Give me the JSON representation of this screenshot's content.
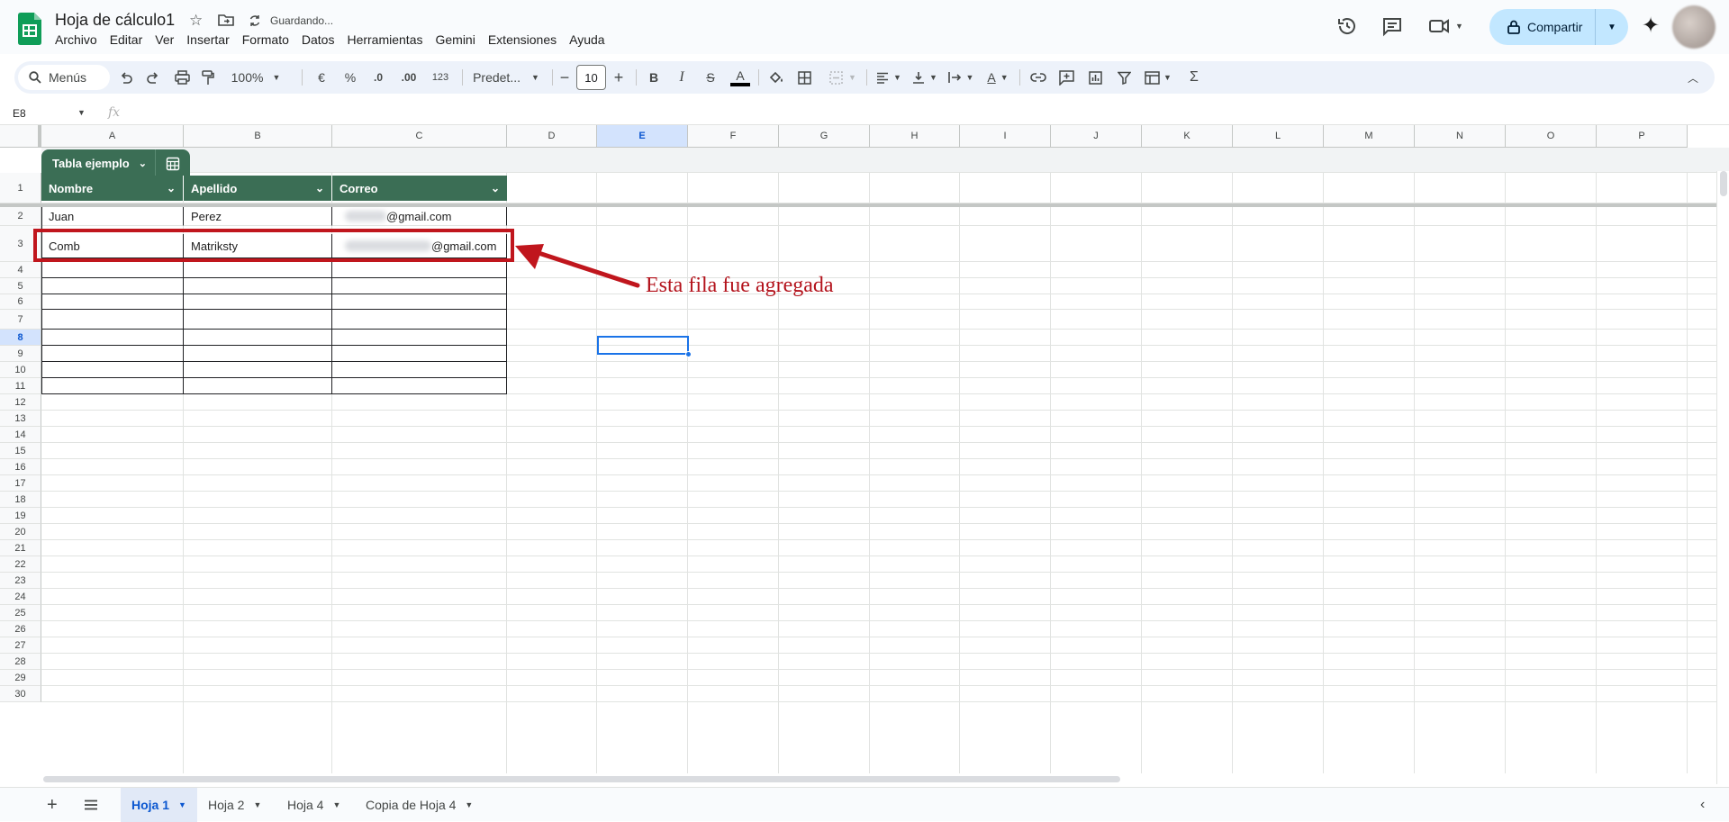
{
  "app": {
    "title": "Hoja de cálculo1",
    "status": "Guardando...",
    "share_label": "Compartir",
    "menu": [
      "Archivo",
      "Editar",
      "Ver",
      "Insertar",
      "Formato",
      "Datos",
      "Herramientas",
      "Gemini",
      "Extensiones",
      "Ayuda"
    ],
    "icons": {
      "star": "star-icon",
      "move": "folder-move-icon",
      "sync": "sync-icon",
      "history": "history-icon",
      "comments": "comments-icon",
      "meet": "video-call-icon",
      "gemini": "gemini-sparkle-icon",
      "lock": "lock-icon"
    }
  },
  "toolbar": {
    "search_label": "Menús",
    "zoom": "100%",
    "currency": "€",
    "percent": "%",
    "dec_less": ".0",
    "dec_more": ".00",
    "num_format": "123",
    "font": "Predet...",
    "font_size": "10",
    "bold": "B",
    "italic": "I",
    "strike": "S",
    "text_color": "A",
    "sum": "Σ"
  },
  "formula_bar": {
    "cell_ref": "E8",
    "fx": "fx",
    "content": ""
  },
  "grid": {
    "columns": [
      "A",
      "B",
      "C",
      "D",
      "E",
      "F",
      "G",
      "H",
      "I",
      "J",
      "K",
      "L",
      "M",
      "N",
      "O",
      "P"
    ],
    "selected_column": "E",
    "rows": [
      "1",
      "2",
      "3",
      "4",
      "5",
      "6",
      "7",
      "8",
      "9",
      "10",
      "11",
      "12",
      "13",
      "14",
      "15",
      "16",
      "17",
      "18",
      "19",
      "20",
      "21",
      "22",
      "23",
      "24",
      "25",
      "26",
      "27",
      "28",
      "29",
      "30"
    ],
    "selected_row": "8",
    "selected_cell": "E8"
  },
  "table": {
    "name": "Tabla ejemplo",
    "headers": [
      "Nombre",
      "Apellido",
      "Correo"
    ],
    "rows": [
      [
        "Juan",
        "Perez",
        "@gmail.com"
      ],
      [
        "Comb",
        "Matriksty",
        "@gmail.com"
      ]
    ],
    "header_color": "#3b6e55"
  },
  "annotation": {
    "text": "Esta fila fue agregada",
    "color": "#c0161d"
  },
  "sheets": {
    "tabs": [
      "Hoja 1",
      "Hoja 2",
      "Hoja 4",
      "Copia de Hoja 4"
    ],
    "active": "Hoja 1"
  }
}
